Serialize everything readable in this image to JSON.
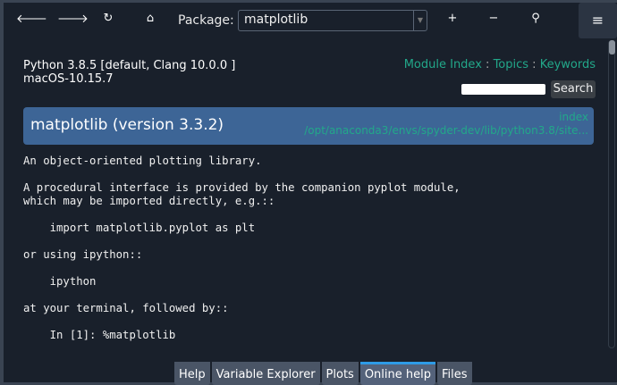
{
  "toolbar": {
    "package_label": "Package:",
    "package_value": "matplotlib"
  },
  "header": {
    "python": "Python 3.8.5 [default, Clang 10.0.0 ]",
    "os": "macOS-10.15.7",
    "links": [
      "Module Index",
      "Topics",
      "Keywords"
    ],
    "sep": " : ",
    "search_label": "Search"
  },
  "banner": {
    "title": "matplotlib (version 3.3.2)",
    "index": "index",
    "path": "/opt/anaconda3/envs/spyder-dev/lib/python3.8/site..."
  },
  "doc": "An object-oriented plotting library.\n\nA procedural interface is provided by the companion pyplot module,\nwhich may be imported directly, e.g.::\n\n    import matplotlib.pyplot as plt\n\nor using ipython::\n\n    ipython\n\nat your terminal, followed by::\n\n    In [1]: %matplotlib",
  "tabs": [
    {
      "label": "Help"
    },
    {
      "label": "Variable Explorer"
    },
    {
      "label": "Plots"
    },
    {
      "label": "Online help",
      "active": true
    },
    {
      "label": "Files"
    }
  ],
  "colors": {
    "link": "#22a88a",
    "banner": "#3d6596",
    "active_tab": "#2e9be6"
  }
}
